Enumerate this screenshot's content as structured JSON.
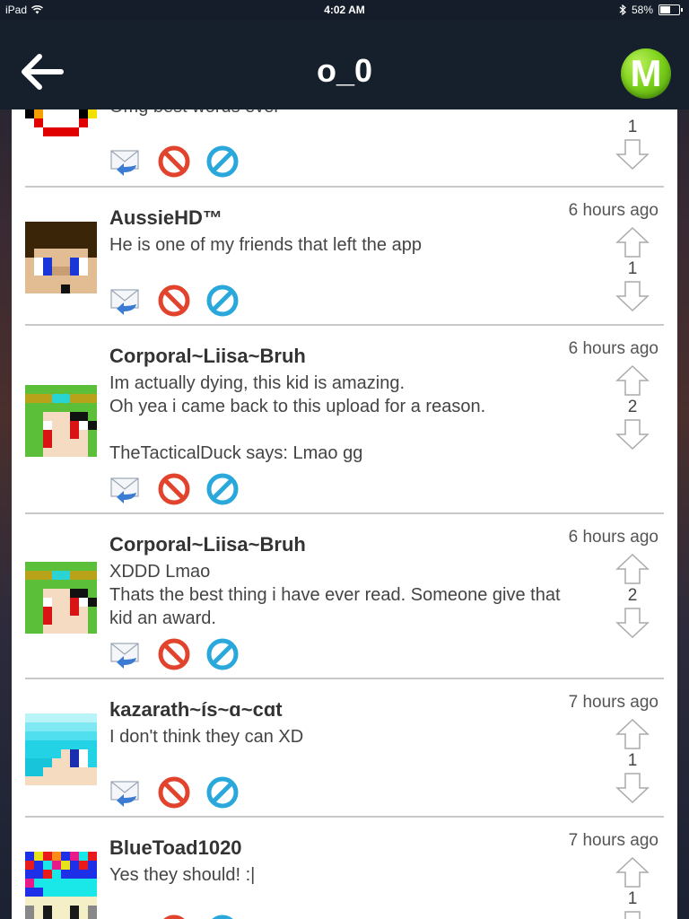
{
  "statusbar": {
    "device": "iPad",
    "time": "4:02 AM",
    "battery": "58%"
  },
  "navbar": {
    "title": "o_0",
    "logo_letter": "M"
  },
  "partial_comment": {
    "text": "Omg best words ever",
    "votes": "1"
  },
  "comments": [
    {
      "username": "AussieHD™",
      "time": "6 hours ago",
      "lines": [
        "He is one of my friends that left the app"
      ],
      "votes": "1",
      "avatar": "aussie"
    },
    {
      "username": "Corporal~Liisa~Bruh",
      "time": "6 hours ago",
      "lines": [
        "Im actually dying, this kid is amazing.",
        "Oh yea i came back to this upload for a reason.",
        "",
        "TheTacticalDuck says: Lmao gg"
      ],
      "votes": "2",
      "avatar": "liisa"
    },
    {
      "username": "Corporal~Liisa~Bruh",
      "time": "6 hours ago",
      "lines": [
        "XDDD Lmao",
        "Thats the best thing i have ever read. Someone give that kid an award."
      ],
      "votes": "2",
      "avatar": "liisa"
    },
    {
      "username": "kazarath~ís~ɑ~cɑt",
      "time": "7 hours ago",
      "lines": [
        "I don't think they can XD"
      ],
      "votes": "1",
      "avatar": "kaz"
    },
    {
      "username": "BlueToad1020",
      "time": "7 hours ago",
      "lines": [
        "Yes they should! :|"
      ],
      "votes": "1",
      "avatar": "toad"
    }
  ]
}
